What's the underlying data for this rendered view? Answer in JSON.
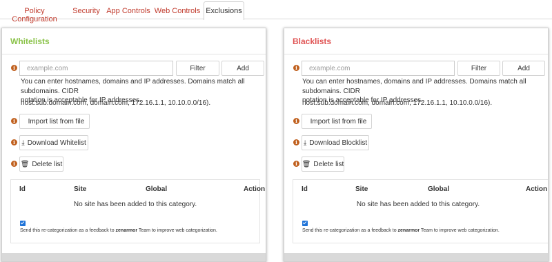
{
  "tabs": [
    {
      "label": "Policy Configuration"
    },
    {
      "label": "Security"
    },
    {
      "label": "App Controls"
    },
    {
      "label": "Web Controls"
    },
    {
      "label": "Exclusions"
    }
  ],
  "active_tab": "Exclusions",
  "colors": {
    "tab_link": "#c0392b",
    "whitelist_title": "#8bc34a",
    "blacklist_title": "#e05555",
    "info_icon": "#c0601e",
    "checkbox": "#1f73d8"
  },
  "whitelist": {
    "title": "Whitelists",
    "input_placeholder": "example.com",
    "filter_label": "Filter",
    "add_label": "Add",
    "help_line1": "You can enter hostnames, domains and IP addresses. Domains match all subdomains. CIDR",
    "help_line2": "notation is acceptable for IP addresses.",
    "help_example": "host.sub.domain.com, domain.com, 172.16.1.1, 10.10.0.0/16).",
    "import_label": "Import list from file",
    "download_label": "Download Whitelist",
    "delete_label": "Delete list",
    "columns": {
      "id": "Id",
      "site": "Site",
      "global": "Global",
      "action": "Action"
    },
    "empty_text": "No site has been added to this category.",
    "feedback_pre": "Send this re-categorization as a feedback to ",
    "feedback_brand": "zenarmor",
    "feedback_post": " Team to improve web categorization.",
    "feedback_checked": true
  },
  "blacklist": {
    "title": "Blacklists",
    "input_placeholder": "example.com",
    "filter_label": "Filter",
    "add_label": "Add",
    "help_line1": "You can enter hostnames, domains and IP addresses. Domains match all subdomains. CIDR",
    "help_line2": "notation is acceptable for IP addresses.",
    "help_example": "host.sub.domain.com, domain.com, 172.16.1.1, 10.10.0.0/16).",
    "import_label": "Import list from file",
    "download_label": "Download Blocklist",
    "delete_label": "Delete list",
    "columns": {
      "id": "Id",
      "site": "Site",
      "global": "Global",
      "action": "Action"
    },
    "empty_text": "No site has been added to this category.",
    "feedback_pre": "Send this re-categorization as a feedback to ",
    "feedback_brand": "zenarmor",
    "feedback_post": " Team to improve web categorization.",
    "feedback_checked": true
  }
}
